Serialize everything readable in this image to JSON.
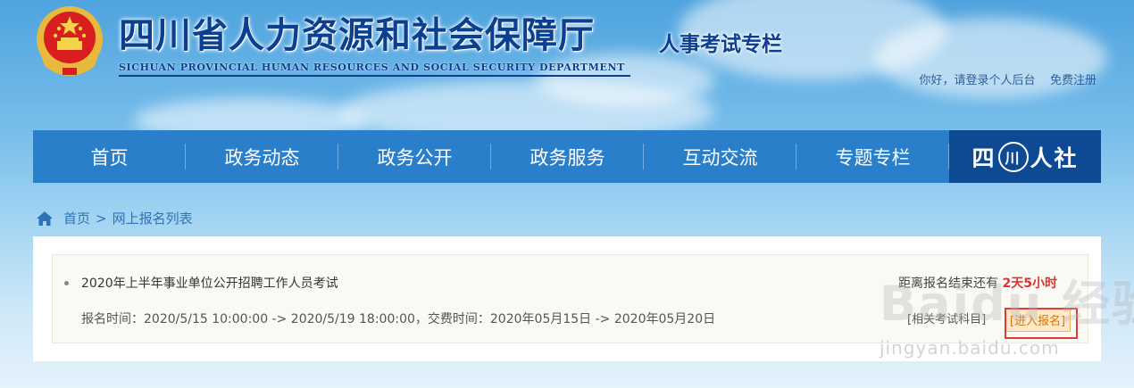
{
  "header": {
    "title": "四川省人力资源和社会保障厅",
    "subtitle": "人事考试专栏",
    "title_en": "SICHUAN PROVINCIAL HUMAN RESOURCES AND SOCIAL SECURITY DEPARTMENT",
    "login_link": "你好，请登录个人后台",
    "register_link": "免费注册"
  },
  "nav": {
    "items": [
      {
        "label": "首页"
      },
      {
        "label": "政务动态"
      },
      {
        "label": "政务公开"
      },
      {
        "label": "政务服务"
      },
      {
        "label": "互动交流"
      },
      {
        "label": "专题专栏"
      }
    ],
    "brand_left": "四",
    "brand_mid": "川",
    "brand_right": "人社"
  },
  "breadcrumb": {
    "home": "首页",
    "separator": ">",
    "current": "网上报名列表"
  },
  "exam": {
    "title": "2020年上半年事业单位公开招聘工作人员考试",
    "countdown_prefix": "距离报名结束还有",
    "countdown_value": "2天5小时",
    "dates": "报名时间：2020/5/15 10:00:00 -> 2020/5/19 18:00:00，交费时间：2020年05月15日 -> 2020年05月20日",
    "related_link": "[相关考试科目]",
    "enter_button": "[进入报名]"
  },
  "watermark": {
    "main": "Baidu 经验",
    "sub": "jingyan.baidu.com"
  },
  "colors": {
    "nav_bg": "#2a7fcb",
    "nav_brand_bg": "#0d4a93",
    "title_blue": "#0b3f8f",
    "countdown_red": "#e0322d",
    "highlight_red": "#e53a32"
  },
  "icons": {
    "emblem": "national-emblem",
    "breadcrumb_home": "home-icon"
  }
}
